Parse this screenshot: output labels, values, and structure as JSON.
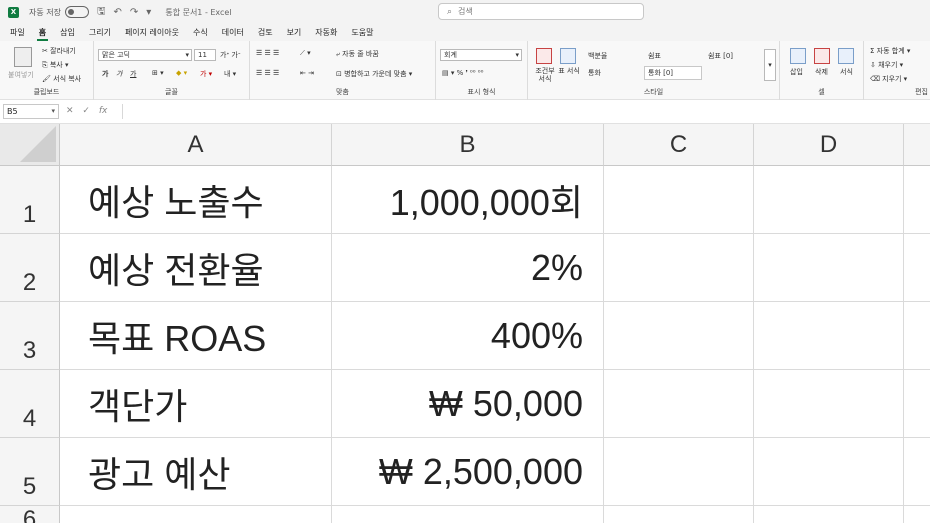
{
  "titlebar": {
    "logo": "X",
    "autosave_label": "자동 저장",
    "toggle_state": "끔",
    "doc_title": "통합 문서1 - Excel",
    "search_placeholder": "검색"
  },
  "menu_tabs": [
    "파일",
    "홈",
    "삽입",
    "그리기",
    "페이지 레이아웃",
    "수식",
    "데이터",
    "검토",
    "보기",
    "자동화",
    "도움말"
  ],
  "ribbon": {
    "clipboard": {
      "paste": "붙여넣기",
      "cut": "잘라내기",
      "copy": "복사",
      "format_painter": "서식 복사",
      "label": "클립보드"
    },
    "font": {
      "name": "맑은 고딕",
      "size": "11",
      "bold": "가",
      "italic": "가",
      "underline": "가",
      "label": "글꼴"
    },
    "alignment": {
      "wrap": "자동 줄 바꿈",
      "merge": "병합하고 가운데 맞춤",
      "label": "맞춤"
    },
    "number": {
      "format": "회계",
      "label": "표시 형식"
    },
    "styles": {
      "conditional": "조건부 서식",
      "table": "표 서식",
      "style1": "백분율",
      "style2": "쉼표",
      "style3": "쉼표 [0]",
      "style4": "통화",
      "style5": "통화 [0]",
      "label": "스타일"
    },
    "cells": {
      "insert": "삽입",
      "delete": "삭제",
      "format": "서식",
      "label": "셀"
    },
    "editing": {
      "autosum": "자동 합계",
      "fill": "채우기",
      "clear": "지우기",
      "label": "편집"
    }
  },
  "formula_bar": {
    "name_box": "B5",
    "fx": "fx",
    "value": ""
  },
  "columns": [
    "A",
    "B",
    "C",
    "D"
  ],
  "rows": [
    {
      "num": "1",
      "a": "예상 노출수",
      "b": "1,000,000회"
    },
    {
      "num": "2",
      "a": "예상 전환율",
      "b": "2%"
    },
    {
      "num": "3",
      "a": "목표 ROAS",
      "b": "400%"
    },
    {
      "num": "4",
      "a": "객단가",
      "b": "₩ 50,000"
    },
    {
      "num": "5",
      "a": "광고 예산",
      "b": "₩ 2,500,000"
    },
    {
      "num": "6",
      "a": "",
      "b": ""
    }
  ]
}
